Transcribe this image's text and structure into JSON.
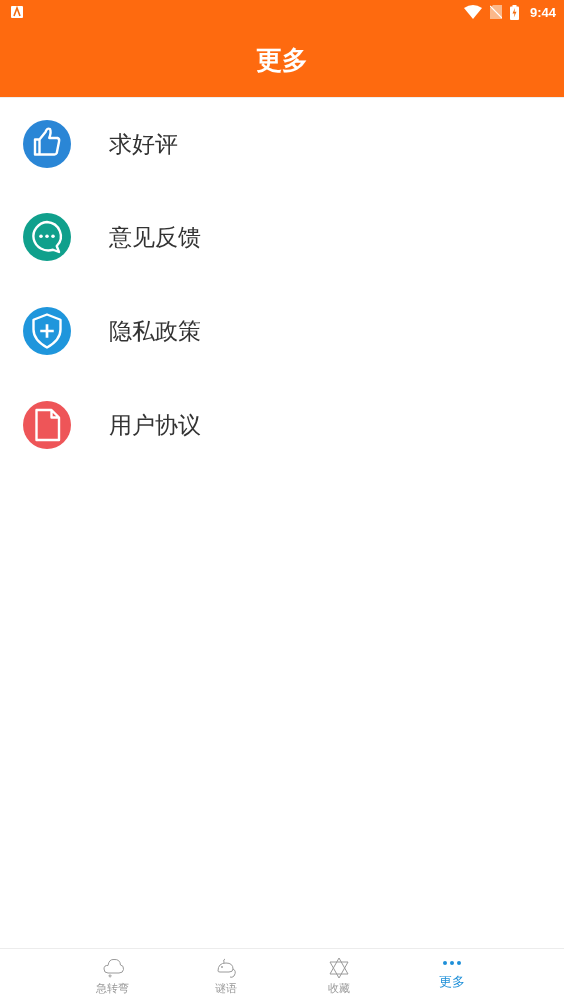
{
  "status_bar": {
    "time": "9:44"
  },
  "header": {
    "title": "更多"
  },
  "menu": [
    {
      "label": "求好评",
      "kind": "thumb",
      "color": "#2a86d6"
    },
    {
      "label": "意见反馈",
      "kind": "chat",
      "color": "#10a08c"
    },
    {
      "label": "隐私政策",
      "kind": "shield",
      "color": "#1f96dc"
    },
    {
      "label": "用户协议",
      "kind": "doc",
      "color": "#ee5558"
    }
  ],
  "tabs": [
    {
      "label": "急转弯",
      "kind": "cloud",
      "selected": false
    },
    {
      "label": "谜语",
      "kind": "mouse",
      "selected": false
    },
    {
      "label": "收藏",
      "kind": "star",
      "selected": false
    },
    {
      "label": "更多",
      "kind": "dots",
      "selected": true
    }
  ]
}
